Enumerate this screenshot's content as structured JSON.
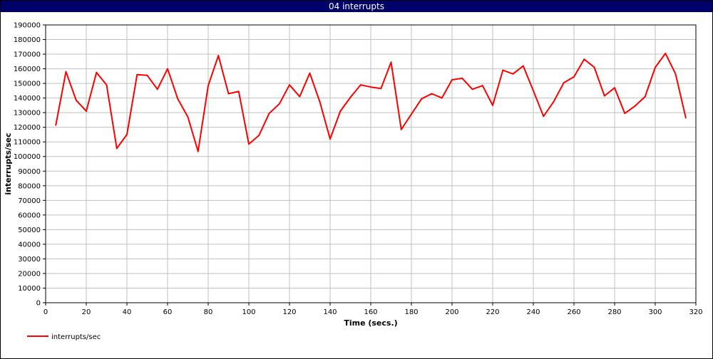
{
  "window": {
    "title": "04 interrupts"
  },
  "colors": {
    "titlebar_bg": "#00006b",
    "series": "#ff0000",
    "grid": "#c0c0c0"
  },
  "chart_data": {
    "type": "line",
    "title": "04 interrupts",
    "xlabel": "Time (secs.)",
    "ylabel": "interrupts/sec",
    "xlim": [
      0,
      320
    ],
    "ylim": [
      0,
      190000
    ],
    "xticks": [
      0,
      20,
      40,
      60,
      80,
      100,
      120,
      140,
      160,
      180,
      200,
      220,
      240,
      260,
      280,
      300,
      320
    ],
    "yticks": [
      0,
      10000,
      20000,
      30000,
      40000,
      50000,
      60000,
      70000,
      80000,
      90000,
      100000,
      110000,
      120000,
      130000,
      140000,
      150000,
      160000,
      170000,
      180000,
      190000
    ],
    "grid": true,
    "legend_position": "bottom-left",
    "series": [
      {
        "name": "interrupts/sec",
        "color": "#ff0000",
        "x": [
          5,
          10,
          15,
          20,
          25,
          30,
          35,
          40,
          45,
          50,
          55,
          60,
          65,
          70,
          75,
          80,
          85,
          90,
          95,
          100,
          105,
          110,
          115,
          120,
          125,
          130,
          135,
          140,
          145,
          150,
          155,
          160,
          165,
          170,
          175,
          180,
          185,
          190,
          195,
          200,
          205,
          210,
          215,
          220,
          225,
          230,
          235,
          240,
          245,
          250,
          255,
          260,
          265,
          270,
          275,
          280,
          285,
          290,
          295,
          300,
          305,
          310,
          315
        ],
        "y": [
          121500,
          158000,
          138500,
          131000,
          157500,
          149000,
          105500,
          115000,
          156000,
          155500,
          146000,
          160000,
          139500,
          127000,
          103500,
          148500,
          169000,
          143000,
          144500,
          108500,
          114500,
          129500,
          136000,
          149000,
          141000,
          157000,
          137000,
          112000,
          131000,
          140500,
          149000,
          147500,
          146500,
          164500,
          118500,
          129000,
          139500,
          143000,
          140000,
          152500,
          153500,
          146000,
          148500,
          135000,
          159000,
          156500,
          162000,
          145000,
          127500,
          137500,
          150500,
          154500,
          166500,
          161000,
          141500,
          147000,
          129500,
          134500,
          141000,
          161000,
          170500,
          156500,
          126500
        ]
      }
    ]
  }
}
